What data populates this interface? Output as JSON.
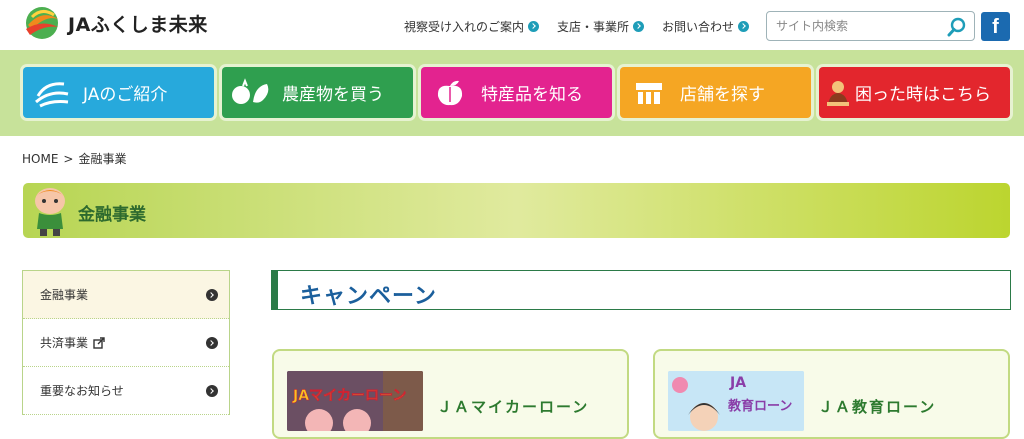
{
  "header": {
    "logo_text": "JAふくしま未来",
    "links": [
      {
        "label": "視察受け入れのご案内"
      },
      {
        "label": "支店・事業所"
      },
      {
        "label": "お問い合わせ"
      }
    ],
    "search_placeholder": "サイト内検索",
    "facebook_label": "f"
  },
  "nav": {
    "items": [
      {
        "label": "JAのご紹介",
        "icon": "ja-logo-icon",
        "color": "#27a9dc"
      },
      {
        "label": "農産物を買う",
        "icon": "produce-icon",
        "color": "#2f9f4f"
      },
      {
        "label": "特産品を知る",
        "icon": "peach-icon",
        "color": "#e3238f"
      },
      {
        "label": "店舗を探す",
        "icon": "store-icon",
        "color": "#f5a623"
      },
      {
        "label": "困った時はこちら",
        "icon": "help-icon",
        "color": "#e3262d"
      }
    ]
  },
  "breadcrumb": {
    "home": "HOME",
    "separator": ">",
    "current": "金融事業"
  },
  "page_title": "金融事業",
  "sidebar": {
    "items": [
      {
        "label": "金融事業"
      },
      {
        "label": "共済事業"
      },
      {
        "label": "重要なお知らせ"
      }
    ]
  },
  "main": {
    "heading": "キャンペーン",
    "cards": [
      {
        "title": "ＪＡマイカーローン",
        "thumb_text": "JAマイカーローン"
      },
      {
        "title": "ＪＡ教育ローン",
        "thumb_text_top": "JA",
        "thumb_text_bottom": "教育ローン"
      }
    ]
  },
  "colors": {
    "accent_green": "#2b7a47",
    "title_blue": "#1b5f9c"
  }
}
